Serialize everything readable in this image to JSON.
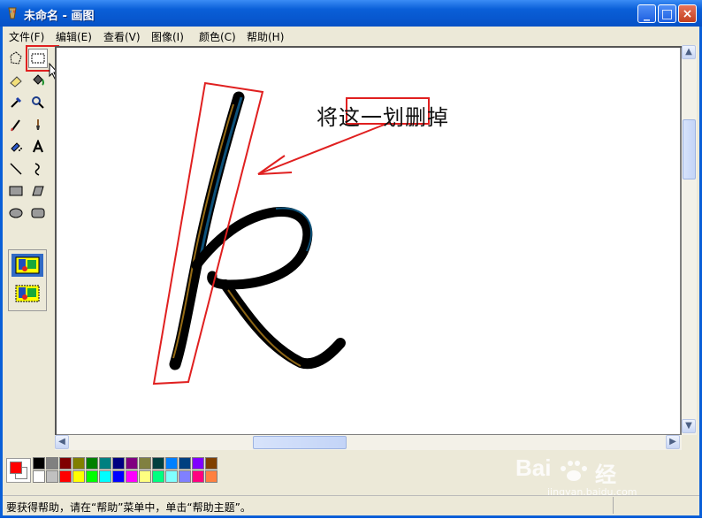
{
  "window": {
    "title": "未命名 - 画图"
  },
  "menu": [
    "文件(F)",
    "编辑(E)",
    "查看(V)",
    "图像(I)",
    "颜色(C)",
    "帮助(H)"
  ],
  "tools": [
    "free-select",
    "rect-select",
    "eraser",
    "fill",
    "color-picker",
    "magnifier",
    "pencil",
    "brush",
    "airbrush",
    "text",
    "line",
    "curve",
    "rectangle",
    "polygon",
    "ellipse",
    "rounded-rect"
  ],
  "selected_tool": "rect-select",
  "canvas_annotation": {
    "text": "将这一划删掉",
    "highlight": "这一划"
  },
  "colors": {
    "foreground": "#ff0000",
    "background": "#ffffff",
    "palette_row1": [
      "#000000",
      "#808080",
      "#800000",
      "#808000",
      "#008000",
      "#008080",
      "#000080",
      "#800080",
      "#808040",
      "#004040",
      "#0080ff",
      "#004080",
      "#8000ff",
      "#804000"
    ],
    "palette_row2": [
      "#ffffff",
      "#c0c0c0",
      "#ff0000",
      "#ffff00",
      "#00ff00",
      "#00ffff",
      "#0000ff",
      "#ff00ff",
      "#ffff80",
      "#00ff80",
      "#80ffff",
      "#8080ff",
      "#ff0080",
      "#ff8040"
    ]
  },
  "status": {
    "text": "要获得帮助，请在“帮助”菜单中，单击“帮助主题”。"
  },
  "watermark": {
    "brand": "Baidu",
    "sub": "经验",
    "url": "jingyan.baidu.com"
  }
}
